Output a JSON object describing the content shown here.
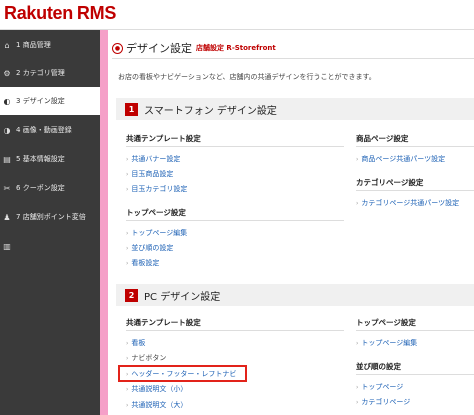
{
  "header": {
    "logo_text": "Rakuten",
    "logo_suffix": "RMS",
    "brand_color": "#bf0000"
  },
  "sidebar": {
    "items": [
      {
        "num": "1",
        "label": "商品管理",
        "icon": "home-icon"
      },
      {
        "num": "2",
        "label": "カテゴリ管理",
        "icon": "gear-icon"
      },
      {
        "num": "3",
        "label": "デザイン設定",
        "icon": "palette-icon",
        "active": true
      },
      {
        "num": "4",
        "label": "画像・動画登録",
        "icon": "image-icon"
      },
      {
        "num": "5",
        "label": "基本情報設定",
        "icon": "list-icon"
      },
      {
        "num": "6",
        "label": "クーポン設定",
        "icon": "ticket-icon"
      },
      {
        "num": "7",
        "label": "店舗別ポイント変倍",
        "icon": "people-icon"
      }
    ]
  },
  "page": {
    "title": "デザイン設定",
    "subtitle": "店舗設定 R-Storefront",
    "description": "お店の看板やナビゲーションなど、店舗内の共通デザインを行うことができます。"
  },
  "sections": {
    "sp": {
      "num": "1",
      "title": "スマートフォン デザイン設定",
      "common_head": "共通テンプレート設定",
      "common_links": [
        "共通バナー設定",
        "目玉商品設定",
        "目玉カテゴリ設定"
      ],
      "top_head": "トップページ設定",
      "top_links": [
        "トップページ編集",
        "並び順の設定",
        "看板設定"
      ],
      "product_head": "商品ページ設定",
      "product_links": [
        "商品ページ共通パーツ設定"
      ],
      "category_head": "カテゴリページ設定",
      "category_links": [
        "カテゴリページ共通パーツ設定"
      ]
    },
    "pc": {
      "num": "2",
      "title": "PC デザイン設定",
      "common_head": "共通テンプレート設定",
      "common_links": [
        "看板",
        "ナビボタン",
        "ヘッダー・フッター・レフトナビ",
        "共通説明文（小）",
        "共通説明文（大）"
      ],
      "top_head": "トップページ設定",
      "top_links": [
        "トップページ編集"
      ],
      "order_head": "並び順の設定",
      "order_links": [
        "トップページ",
        "カテゴリページ"
      ]
    }
  }
}
